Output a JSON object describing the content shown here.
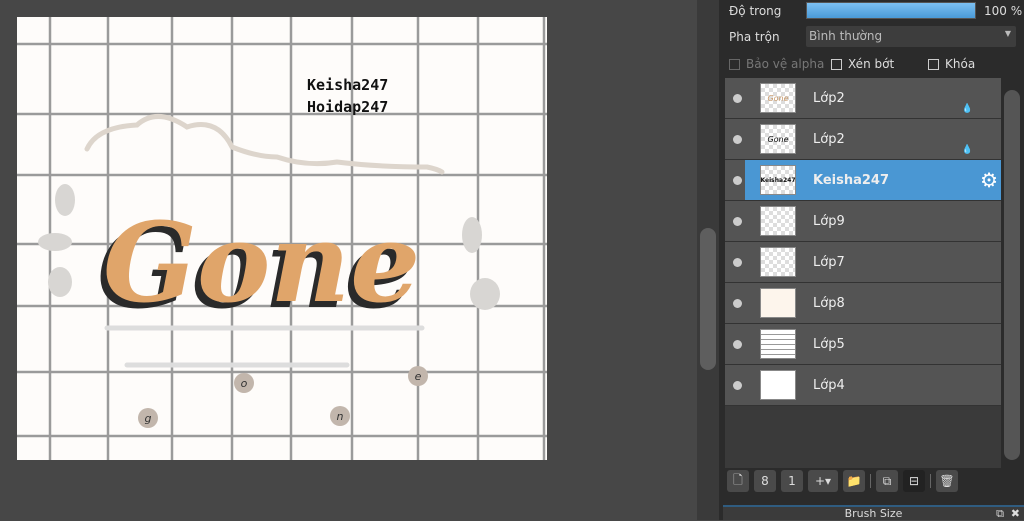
{
  "canvas": {
    "watermark": [
      "Keisha247",
      "Hoidap247"
    ],
    "title_art": "Gone",
    "letters": [
      "g",
      "o",
      "n",
      "e"
    ]
  },
  "panel": {
    "opacity_label": "Độ trong",
    "opacity_value": "100 %",
    "opacity_percent": 100,
    "blend_label": "Pha trộn",
    "blend_value": "Bình thường",
    "protect_alpha": "Bảo vệ alpha",
    "clip": "Xén bớt",
    "lock": "Khóa",
    "layers": [
      {
        "name": "Lớp2",
        "thumb": "Gone"
      },
      {
        "name": "Lớp2",
        "thumb": "Gone"
      },
      {
        "name": "Keisha247",
        "thumb": "Keisha247",
        "selected": true
      },
      {
        "name": "Lớp9"
      },
      {
        "name": "Lớp7"
      },
      {
        "name": "Lớp8"
      },
      {
        "name": "Lớp5"
      },
      {
        "name": "Lớp4"
      }
    ],
    "brush_size_title": "Brush Size"
  }
}
